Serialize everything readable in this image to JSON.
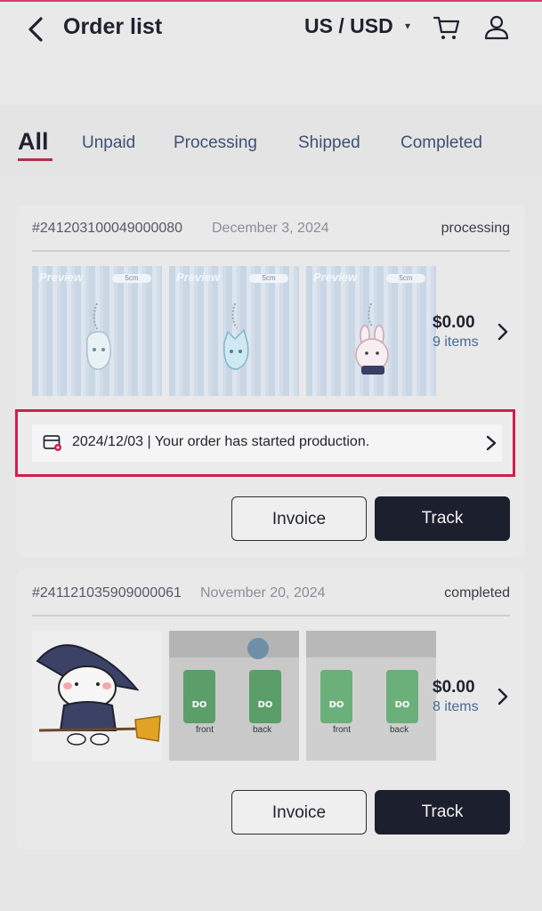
{
  "header": {
    "title": "Order list",
    "currency": "US / USD"
  },
  "tabs": [
    "All",
    "Unpaid",
    "Processing",
    "Shipped",
    "Completed"
  ],
  "orders": [
    {
      "number": "#241203100049000080",
      "date": "December 3, 2024",
      "status": "processing",
      "thumb_label": "Preview",
      "thumb_size": "5cm",
      "price": "$0.00",
      "items": "9 items",
      "notice": "2024/12/03 | Your order has started production.",
      "invoice_label": "Invoice",
      "track_label": "Track"
    },
    {
      "number": "#241121035909000061",
      "date": "November 20, 2024",
      "status": "completed",
      "front_label": "front",
      "back_label": "back",
      "price": "$0.00",
      "items": "8 items",
      "invoice_label": "Invoice",
      "track_label": "Track"
    }
  ],
  "icons": {
    "back": "chevron-left-icon",
    "cart": "cart-icon",
    "user": "user-icon",
    "notice": "production-calendar-icon"
  },
  "colors": {
    "accent": "#d21e4c",
    "dark_button": "#1c1f2d",
    "link": "#476b96"
  }
}
